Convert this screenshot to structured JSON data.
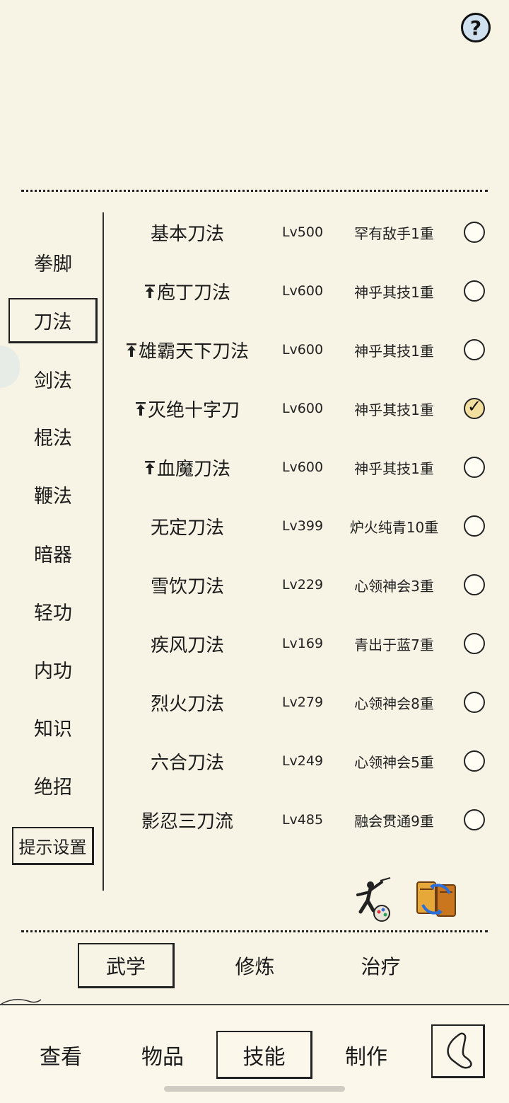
{
  "help": {
    "glyph": "?"
  },
  "categories": [
    {
      "label": "拳脚"
    },
    {
      "label": "刀法"
    },
    {
      "label": "剑法"
    },
    {
      "label": "棍法"
    },
    {
      "label": "鞭法"
    },
    {
      "label": "暗器"
    },
    {
      "label": "轻功"
    },
    {
      "label": "内功"
    },
    {
      "label": "知识"
    },
    {
      "label": "绝招"
    }
  ],
  "selected_category": "刀法",
  "hint_button": {
    "label": "提示设置"
  },
  "skills": [
    {
      "name": "基本刀法",
      "level": "Lv500",
      "rank": "罕有敌手1重",
      "upgrade": false,
      "checked": false
    },
    {
      "name": "庖丁刀法",
      "level": "Lv600",
      "rank": "神乎其技1重",
      "upgrade": true,
      "checked": false
    },
    {
      "name": "雄霸天下刀法",
      "level": "Lv600",
      "rank": "神乎其技1重",
      "upgrade": true,
      "checked": false
    },
    {
      "name": "灭绝十字刀",
      "level": "Lv600",
      "rank": "神乎其技1重",
      "upgrade": true,
      "checked": true
    },
    {
      "name": "血魔刀法",
      "level": "Lv600",
      "rank": "神乎其技1重",
      "upgrade": true,
      "checked": false
    },
    {
      "name": "无定刀法",
      "level": "Lv399",
      "rank": "炉火纯青10重",
      "upgrade": false,
      "checked": false
    },
    {
      "name": "雪饮刀法",
      "level": "Lv229",
      "rank": "心领神会3重",
      "upgrade": false,
      "checked": false
    },
    {
      "name": "疾风刀法",
      "level": "Lv169",
      "rank": "青出于蓝7重",
      "upgrade": false,
      "checked": false
    },
    {
      "name": "烈火刀法",
      "level": "Lv279",
      "rank": "心领神会8重",
      "upgrade": false,
      "checked": false
    },
    {
      "name": "六合刀法",
      "level": "Lv249",
      "rank": "心领神会5重",
      "upgrade": false,
      "checked": false
    },
    {
      "name": "影忍三刀流",
      "level": "Lv485",
      "rank": "融会贯通9重",
      "upgrade": false,
      "checked": false
    }
  ],
  "upgrade_icon": "arrow-up-icon",
  "check_glyph": "✓",
  "action_icons": [
    "martial-figure-icon",
    "scroll-swap-icon"
  ],
  "sub_tabs": [
    {
      "label": "武学",
      "selected": true
    },
    {
      "label": "修炼",
      "selected": false
    },
    {
      "label": "治疗",
      "selected": false
    }
  ],
  "bottom_nav": [
    {
      "label": "查看",
      "selected": false
    },
    {
      "label": "物品",
      "selected": false
    },
    {
      "label": "技能",
      "selected": true
    },
    {
      "label": "制作",
      "selected": false
    }
  ],
  "colors": {
    "background": "#f8f4e5",
    "checked_fill": "#f3dfa0",
    "help_fill": "#cfe0ee"
  }
}
